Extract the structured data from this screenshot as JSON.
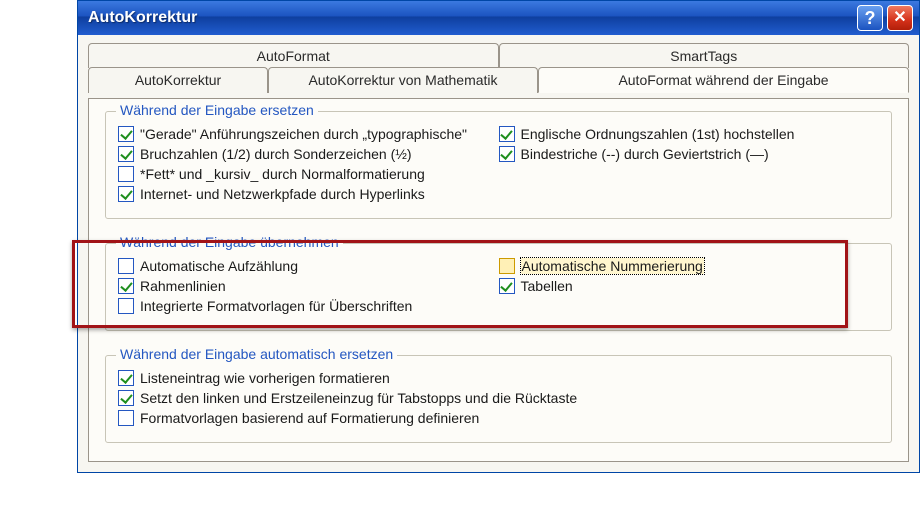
{
  "window": {
    "title": "AutoKorrektur"
  },
  "tabs": {
    "row1": [
      "AutoFormat",
      "SmartTags"
    ],
    "row2": [
      "AutoKorrektur",
      "AutoKorrektur von Mathematik",
      "AutoFormat während der Eingabe"
    ],
    "active": "AutoFormat während der Eingabe"
  },
  "groups": {
    "g1": {
      "title": "Während der Eingabe ersetzen",
      "left": [
        {
          "label": "\"Gerade\" Anführungszeichen durch „typographische\"",
          "checked": true
        },
        {
          "label": "Bruchzahlen (1/2) durch Sonderzeichen (½)",
          "checked": true
        },
        {
          "label": "*Fett* und _kursiv_ durch Normalformatierung",
          "checked": false
        },
        {
          "label": "Internet- und Netzwerkpfade durch Hyperlinks",
          "checked": true
        }
      ],
      "right": [
        {
          "label": "Englische Ordnungszahlen (1st) hochstellen",
          "checked": true
        },
        {
          "label": "Bindestriche (--) durch Geviertstrich (—)",
          "checked": true
        }
      ]
    },
    "g2": {
      "title": "Während der Eingabe übernehmen",
      "left": [
        {
          "label": "Automatische Aufzählung",
          "checked": false
        },
        {
          "label": "Rahmenlinien",
          "checked": true
        },
        {
          "label": "Integrierte Formatvorlagen für Überschriften",
          "checked": false
        }
      ],
      "right": [
        {
          "label": "Automatische Nummerierung",
          "checked": false,
          "focused": true
        },
        {
          "label": "Tabellen",
          "checked": true
        }
      ]
    },
    "g3": {
      "title": "Während der Eingabe automatisch ersetzen",
      "left": [
        {
          "label": "Listeneintrag wie vorherigen formatieren",
          "checked": true
        },
        {
          "label": "Setzt den linken und Erstzeileneinzug für Tabstopps und die Rücktaste",
          "checked": true
        },
        {
          "label": "Formatvorlagen basierend auf Formatierung definieren",
          "checked": false
        }
      ],
      "right": []
    }
  }
}
